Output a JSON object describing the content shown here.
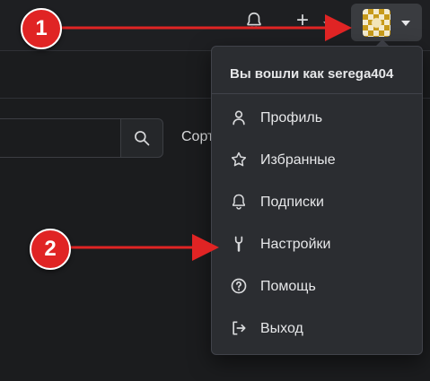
{
  "header": {
    "icons": [
      "bell-icon",
      "plus-icon",
      "chevron-down-icon"
    ],
    "avatar_alt": "user avatar"
  },
  "toolbar": {
    "sort_label": "Сорт"
  },
  "user_menu": {
    "header": "Вы вошли как serega404",
    "items": [
      {
        "label": "Профиль",
        "icon": "person-icon"
      },
      {
        "label": "Избранные",
        "icon": "star-icon"
      },
      {
        "label": "Подписки",
        "icon": "bell-icon"
      },
      {
        "label": "Настройки",
        "icon": "wrench-icon"
      },
      {
        "label": "Помощь",
        "icon": "question-icon"
      },
      {
        "label": "Выход",
        "icon": "sign-out-icon"
      }
    ]
  },
  "annotations": {
    "badge_1": "1",
    "badge_2": "2",
    "accent_color": "#e02424"
  }
}
